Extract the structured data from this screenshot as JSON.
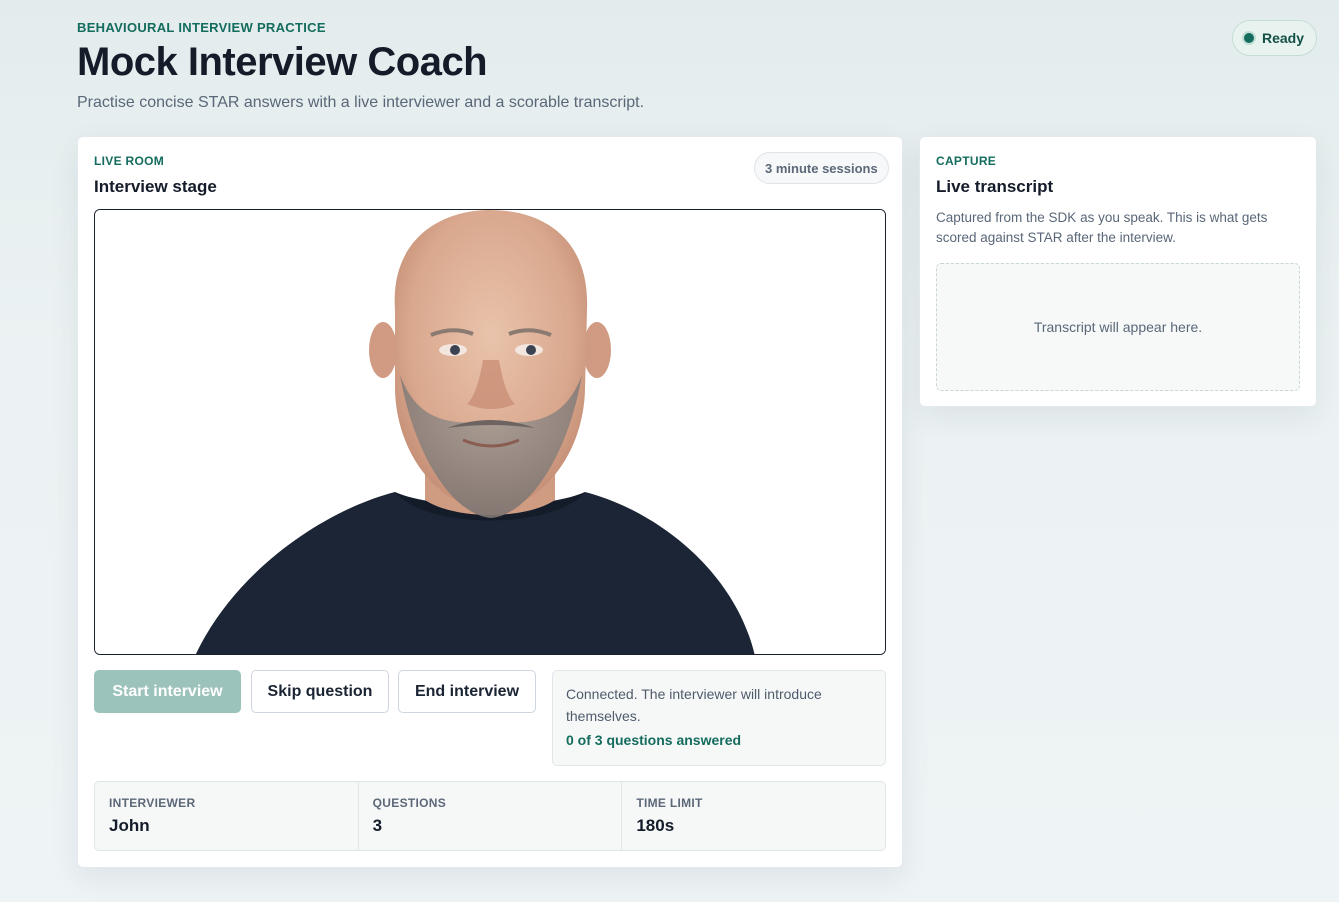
{
  "header": {
    "eyebrow": "BEHAVIOURAL INTERVIEW PRACTICE",
    "title": "Mock Interview Coach",
    "subtitle": "Practise concise STAR answers with a live interviewer and a scorable transcript.",
    "status": "Ready"
  },
  "live_room": {
    "eyebrow": "LIVE ROOM",
    "title": "Interview stage",
    "session_badge": "3 minute sessions",
    "buttons": {
      "start": "Start interview",
      "skip": "Skip question",
      "end": "End interview"
    },
    "status_message": "Connected. The interviewer will introduce themselves.",
    "progress": "0 of 3 questions answered",
    "stats": [
      {
        "label": "INTERVIEWER",
        "value": "John"
      },
      {
        "label": "QUESTIONS",
        "value": "3"
      },
      {
        "label": "TIME LIMIT",
        "value": "180s"
      }
    ]
  },
  "capture": {
    "eyebrow": "CAPTURE",
    "title": "Live transcript",
    "description": "Captured from the SDK as you speak. This is what gets scored against STAR after the interview.",
    "placeholder": "Transcript will appear here."
  },
  "colors": {
    "accent": "#136c5d",
    "start_button_disabled": "#9cc2bc",
    "ready_dot": "#136c5d"
  },
  "icons": [
    "status-dot-icon"
  ]
}
